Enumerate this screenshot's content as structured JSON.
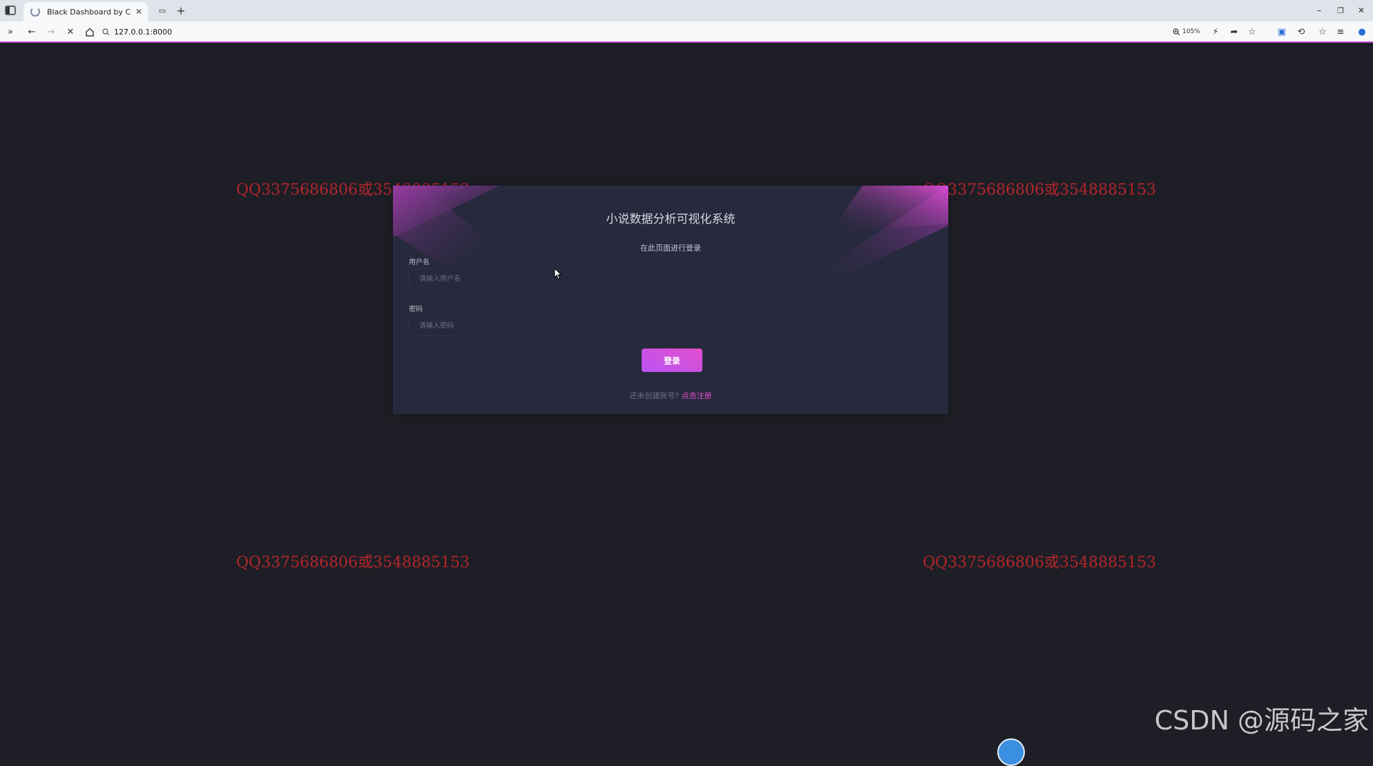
{
  "browser": {
    "tab_title": "Black Dashboard by Creative",
    "url": "127.0.0.1:8000",
    "zoom": "105%"
  },
  "page": {
    "title": "小说数据分析可视化系统",
    "subtitle": "在此页面进行登录",
    "username_label": "用户名",
    "username_placeholder": "请输入用户名",
    "password_label": "密码",
    "password_placeholder": "请输入密码",
    "login_button": "登录",
    "register_prompt": "还未创建账号?",
    "register_link": "点击注册"
  },
  "watermarks": {
    "qq": "QQ3375686806或3548885153",
    "csdn": "CSDN @源码之家"
  },
  "colors": {
    "accent": "#e14eca",
    "card_bg": "#27293d",
    "page_bg": "#1e1e26",
    "watermark": "#b3262b"
  }
}
